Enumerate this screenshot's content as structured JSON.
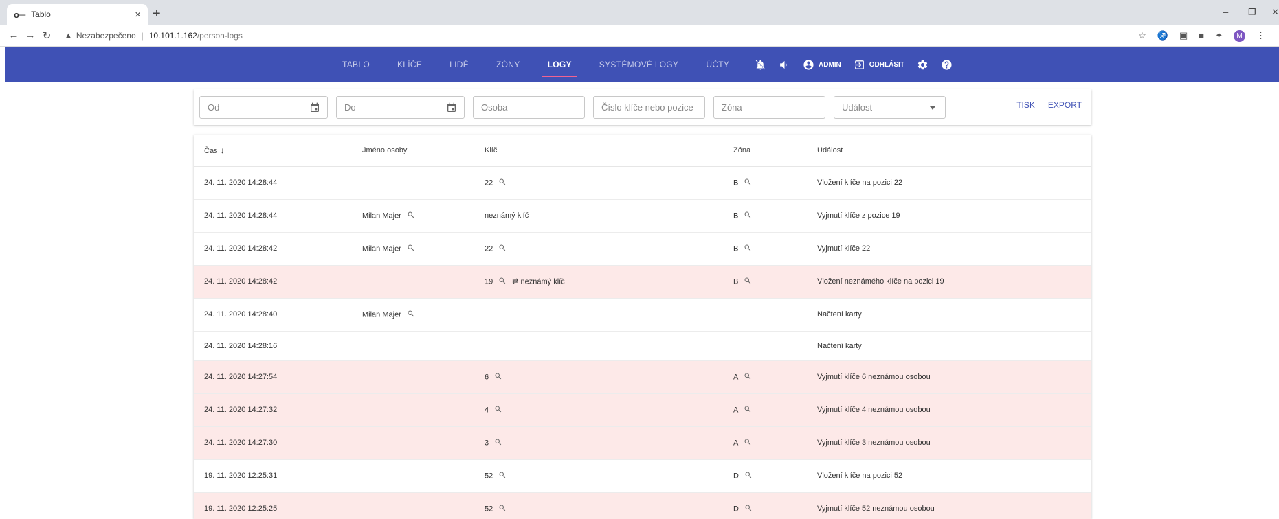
{
  "browser": {
    "tab_title": "Tablo",
    "tab_close": "×",
    "new_tab": "+",
    "insecure_label": "Nezabezpečeno",
    "url_host": "10.101.1.162",
    "url_path": "/person-logs",
    "avatar_letter": "M"
  },
  "nav": {
    "items": [
      "TABLO",
      "KLÍČE",
      "LIDÉ",
      "ZÓNY",
      "LOGY",
      "SYSTÉMOVÉ LOGY",
      "ÚČTY"
    ],
    "active": "LOGY",
    "admin_label": "ADMIN",
    "logout_label": "ODHLÁSIT"
  },
  "filters": {
    "od_placeholder": "Od",
    "do_placeholder": "Do",
    "osoba_placeholder": "Osoba",
    "klic_placeholder": "Číslo klíče nebo pozice",
    "zona_placeholder": "Zóna",
    "udalost_placeholder": "Událost",
    "print_label": "TISK",
    "export_label": "EXPORT"
  },
  "table": {
    "headers": {
      "time": "Čas",
      "time_sort": "↓",
      "name": "Jméno osoby",
      "key": "Klíč",
      "zone": "Zóna",
      "event": "Událost"
    },
    "rows": [
      {
        "time": "24. 11. 2020 14:28:44",
        "name": "",
        "key": "22",
        "key_extra": "",
        "zone": "B",
        "event": "Vložení klíče na pozici 22",
        "error": false
      },
      {
        "time": "24. 11. 2020 14:28:44",
        "name": "Milan Majer",
        "key": "neznámý klíč",
        "key_extra": "",
        "zone": "B",
        "event": "Vyjmutí klíče z pozice 19",
        "error": false
      },
      {
        "time": "24. 11. 2020 14:28:42",
        "name": "Milan Majer",
        "key": "22",
        "key_extra": "",
        "zone": "B",
        "event": "Vyjmutí klíče 22",
        "error": false
      },
      {
        "time": "24. 11. 2020 14:28:42",
        "name": "",
        "key": "19",
        "key_extra": "neznámý klíč",
        "zone": "B",
        "event": "Vložení neznámého klíče na pozici 19",
        "error": true
      },
      {
        "time": "24. 11. 2020 14:28:40",
        "name": "Milan Majer",
        "key": "",
        "key_extra": "",
        "zone": "",
        "event": "Načtení karty",
        "error": false
      },
      {
        "time": "24. 11. 2020 14:28:16",
        "name": "",
        "key": "",
        "key_extra": "",
        "zone": "",
        "event": "Načtení karty",
        "error": false
      },
      {
        "time": "24. 11. 2020 14:27:54",
        "name": "",
        "key": "6",
        "key_extra": "",
        "zone": "A",
        "event": "Vyjmutí klíče 6 neznámou osobou",
        "error": true
      },
      {
        "time": "24. 11. 2020 14:27:32",
        "name": "",
        "key": "4",
        "key_extra": "",
        "zone": "A",
        "event": "Vyjmutí klíče 4 neznámou osobou",
        "error": true
      },
      {
        "time": "24. 11. 2020 14:27:30",
        "name": "",
        "key": "3",
        "key_extra": "",
        "zone": "A",
        "event": "Vyjmutí klíče 3 neznámou osobou",
        "error": true
      },
      {
        "time": "19. 11. 2020 12:25:31",
        "name": "",
        "key": "52",
        "key_extra": "",
        "zone": "D",
        "event": "Vložení klíče na pozici 52",
        "error": false
      },
      {
        "time": "19. 11. 2020 12:25:25",
        "name": "",
        "key": "52",
        "key_extra": "",
        "zone": "D",
        "event": "Vyjmutí klíče 52 neznámou osobou",
        "error": true
      }
    ]
  },
  "colors": {
    "appbar": "#3f51b5",
    "active_underline": "#f06292",
    "error_row": "#fde9e8"
  }
}
